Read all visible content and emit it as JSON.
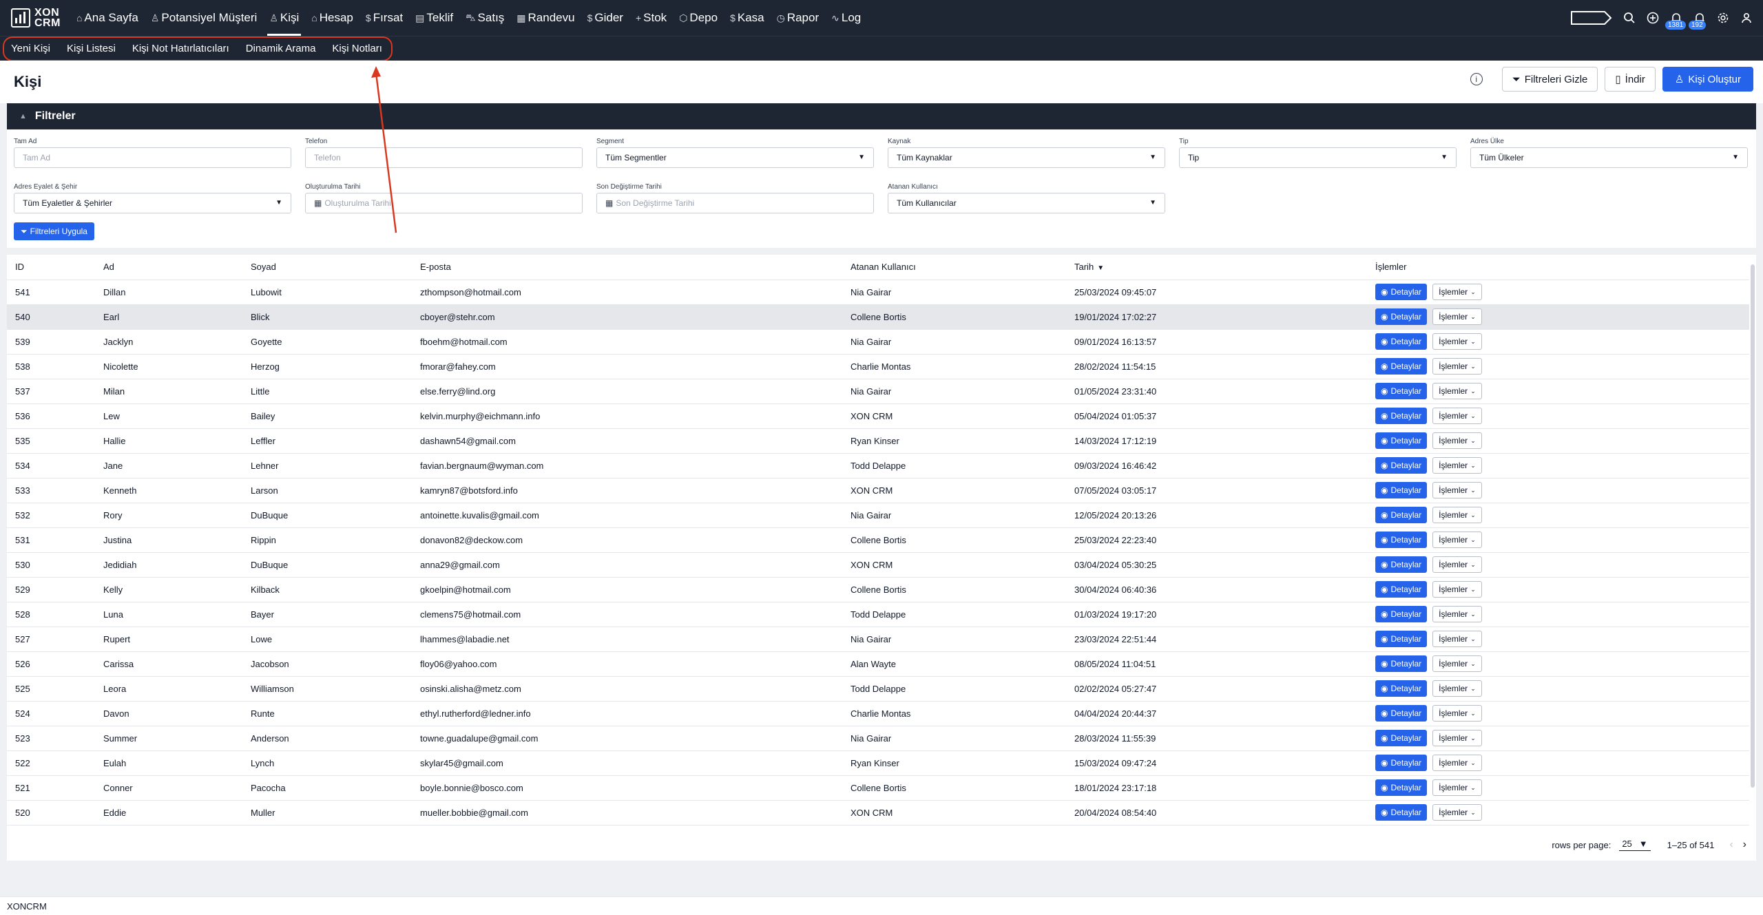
{
  "app": {
    "logo_line1": "XON",
    "logo_line2": "CRM",
    "footer": "XONCRM",
    "accent_color": "#2563eb",
    "nav_bg_color": "#1e2533",
    "annotation_color": "#d9381e"
  },
  "nav": [
    {
      "label": "Ana Sayfa",
      "icon": "home-icon",
      "glyph": "⌂"
    },
    {
      "label": "Potansiyel Müşteri",
      "icon": "user-icon",
      "glyph": "♙"
    },
    {
      "label": "Kişi",
      "icon": "users-icon",
      "glyph": "♙",
      "active": true
    },
    {
      "label": "Hesap",
      "icon": "building-icon",
      "glyph": "⌂"
    },
    {
      "label": "Fırsat",
      "icon": "dollar-icon",
      "glyph": "$"
    },
    {
      "label": "Teklif",
      "icon": "document-icon",
      "glyph": "▤"
    },
    {
      "label": "Satış",
      "icon": "cart-icon",
      "glyph": "⛍"
    },
    {
      "label": "Randevu",
      "icon": "calendar-icon",
      "glyph": "▦"
    },
    {
      "label": "Gider",
      "icon": "dollar-icon",
      "glyph": "$"
    },
    {
      "label": "Stok",
      "icon": "plus-icon",
      "glyph": "+"
    },
    {
      "label": "Depo",
      "icon": "box-icon",
      "glyph": "⬡"
    },
    {
      "label": "Kasa",
      "icon": "dollar-icon",
      "glyph": "$"
    },
    {
      "label": "Rapor",
      "icon": "clock-icon",
      "glyph": "◷"
    },
    {
      "label": "Log",
      "icon": "activity-icon",
      "glyph": "∿"
    }
  ],
  "top_right": {
    "notifications_count": "1381",
    "messages_count": "192"
  },
  "subnav": [
    "Yeni Kişi",
    "Kişi Listesi",
    "Kişi Not Hatırlatıcıları",
    "Dinamik Arama",
    "Kişi Notları"
  ],
  "header": {
    "title": "Kişi",
    "hide_filters": "Filtreleri Gizle",
    "download": "İndir",
    "create": "Kişi Oluştur"
  },
  "filters": {
    "title": "Filtreler",
    "full_name_label": "Tam Ad",
    "full_name_placeholder": "Tam Ad",
    "phone_label": "Telefon",
    "phone_placeholder": "Telefon",
    "segment_label": "Segment",
    "segment_value": "Tüm Segmentler",
    "source_label": "Kaynak",
    "source_value": "Tüm Kaynaklar",
    "type_label": "Tip",
    "type_value": "Tip",
    "country_label": "Adres Ülke",
    "country_value": "Tüm Ülkeler",
    "state_label": "Adres Eyalet & Şehir",
    "state_value": "Tüm Eyaletler & Şehirler",
    "created_label": "Oluşturulma Tarihi",
    "created_placeholder": "Oluşturulma Tarihi",
    "modified_label": "Son Değiştirme Tarihi",
    "modified_placeholder": "Son Değiştirme Tarihi",
    "assigned_label": "Atanan Kullanıcı",
    "assigned_value": "Tüm Kullanıcılar",
    "apply": "Filtreleri Uygula"
  },
  "table": {
    "columns": [
      "ID",
      "Ad",
      "Soyad",
      "E-posta",
      "Atanan Kullanıcı",
      "Tarih",
      "İşlemler"
    ],
    "details_label": "Detaylar",
    "actions_label": "İşlemler",
    "rows": [
      [
        "541",
        "Dillan",
        "Lubowit",
        "zthompson@hotmail.com",
        "Nia Gairar",
        "25/03/2024 09:45:07"
      ],
      [
        "540",
        "Earl",
        "Blick",
        "cboyer@stehr.com",
        "Collene Bortis",
        "19/01/2024 17:02:27"
      ],
      [
        "539",
        "Jacklyn",
        "Goyette",
        "fboehm@hotmail.com",
        "Nia Gairar",
        "09/01/2024 16:13:57"
      ],
      [
        "538",
        "Nicolette",
        "Herzog",
        "fmorar@fahey.com",
        "Charlie Montas",
        "28/02/2024 11:54:15"
      ],
      [
        "537",
        "Milan",
        "Little",
        "else.ferry@lind.org",
        "Nia Gairar",
        "01/05/2024 23:31:40"
      ],
      [
        "536",
        "Lew",
        "Bailey",
        "kelvin.murphy@eichmann.info",
        "XON CRM",
        "05/04/2024 01:05:37"
      ],
      [
        "535",
        "Hallie",
        "Leffler",
        "dashawn54@gmail.com",
        "Ryan Kinser",
        "14/03/2024 17:12:19"
      ],
      [
        "534",
        "Jane",
        "Lehner",
        "favian.bergnaum@wyman.com",
        "Todd Delappe",
        "09/03/2024 16:46:42"
      ],
      [
        "533",
        "Kenneth",
        "Larson",
        "kamryn87@botsford.info",
        "XON CRM",
        "07/05/2024 03:05:17"
      ],
      [
        "532",
        "Rory",
        "DuBuque",
        "antoinette.kuvalis@gmail.com",
        "Nia Gairar",
        "12/05/2024 20:13:26"
      ],
      [
        "531",
        "Justina",
        "Rippin",
        "donavon82@deckow.com",
        "Collene Bortis",
        "25/03/2024 22:23:40"
      ],
      [
        "530",
        "Jedidiah",
        "DuBuque",
        "anna29@gmail.com",
        "XON CRM",
        "03/04/2024 05:30:25"
      ],
      [
        "529",
        "Kelly",
        "Kilback",
        "gkoelpin@hotmail.com",
        "Collene Bortis",
        "30/04/2024 06:40:36"
      ],
      [
        "528",
        "Luna",
        "Bayer",
        "clemens75@hotmail.com",
        "Todd Delappe",
        "01/03/2024 19:17:20"
      ],
      [
        "527",
        "Rupert",
        "Lowe",
        "lhammes@labadie.net",
        "Nia Gairar",
        "23/03/2024 22:51:44"
      ],
      [
        "526",
        "Carissa",
        "Jacobson",
        "floy06@yahoo.com",
        "Alan Wayte",
        "08/05/2024 11:04:51"
      ],
      [
        "525",
        "Leora",
        "Williamson",
        "osinski.alisha@metz.com",
        "Todd Delappe",
        "02/02/2024 05:27:47"
      ],
      [
        "524",
        "Davon",
        "Runte",
        "ethyl.rutherford@ledner.info",
        "Charlie Montas",
        "04/04/2024 20:44:37"
      ],
      [
        "523",
        "Summer",
        "Anderson",
        "towne.guadalupe@gmail.com",
        "Nia Gairar",
        "28/03/2024 11:55:39"
      ],
      [
        "522",
        "Eulah",
        "Lynch",
        "skylar45@gmail.com",
        "Ryan Kinser",
        "15/03/2024 09:47:24"
      ],
      [
        "521",
        "Conner",
        "Pacocha",
        "boyle.bonnie@bosco.com",
        "Collene Bortis",
        "18/01/2024 23:17:18"
      ],
      [
        "520",
        "Eddie",
        "Muller",
        "mueller.bobbie@gmail.com",
        "XON CRM",
        "20/04/2024 08:54:40"
      ]
    ]
  },
  "pagination": {
    "rows_per_page_label": "rows per page:",
    "rows_per_page_value": "25",
    "range": "1–25 of 541"
  }
}
